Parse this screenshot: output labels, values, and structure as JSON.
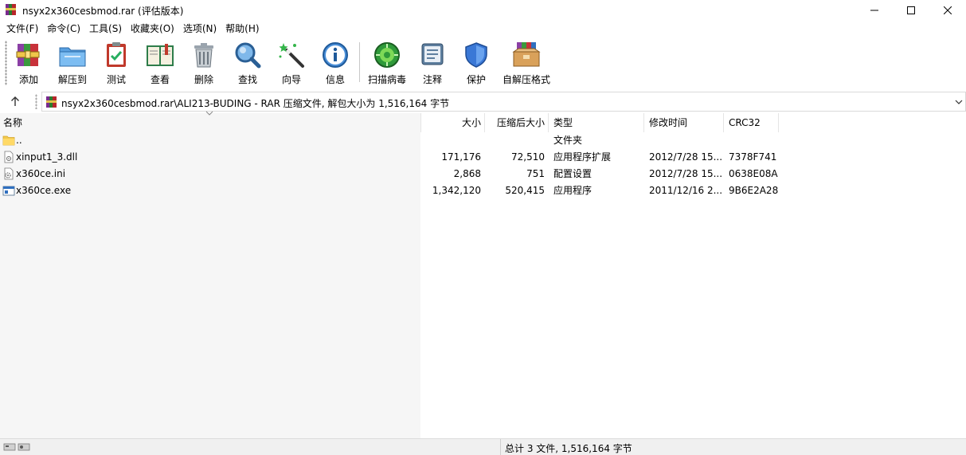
{
  "window": {
    "title": "nsyx2x360cesbmod.rar (评估版本)"
  },
  "menu": [
    "文件(F)",
    "命令(C)",
    "工具(S)",
    "收藏夹(O)",
    "选项(N)",
    "帮助(H)"
  ],
  "toolbar": {
    "buttons": [
      {
        "label": "添加",
        "icon": "add-archive-icon"
      },
      {
        "label": "解压到",
        "icon": "extract-folder-icon"
      },
      {
        "label": "测试",
        "icon": "test-clipboard-icon"
      },
      {
        "label": "查看",
        "icon": "view-book-icon"
      },
      {
        "label": "删除",
        "icon": "trash-icon"
      },
      {
        "label": "查找",
        "icon": "magnifier-icon"
      },
      {
        "label": "向导",
        "icon": "wizard-wand-icon"
      },
      {
        "label": "信息",
        "icon": "info-icon"
      },
      {
        "label": "扫描病毒",
        "icon": "virus-scan-icon"
      },
      {
        "label": "注释",
        "icon": "comment-icon"
      },
      {
        "label": "保护",
        "icon": "shield-icon"
      },
      {
        "label": "自解压格式",
        "icon": "sfx-box-icon"
      }
    ]
  },
  "address": {
    "path": "nsyx2x360cesbmod.rar\\ALI213-BUDING - RAR 压缩文件, 解包大小为 1,516,164 字节"
  },
  "columns": {
    "name": "名称",
    "size": "大小",
    "packed": "压缩后大小",
    "type": "类型",
    "modified": "修改时间",
    "crc": "CRC32"
  },
  "files": [
    {
      "name": "..",
      "size": "",
      "packed": "",
      "type": "文件夹",
      "modified": "",
      "crc": "",
      "icon": "folder-icon"
    },
    {
      "name": "xinput1_3.dll",
      "size": "171,176",
      "packed": "72,510",
      "type": "应用程序扩展",
      "modified": "2012/7/28 15...",
      "crc": "7378F741",
      "icon": "dll-file-icon"
    },
    {
      "name": "x360ce.ini",
      "size": "2,868",
      "packed": "751",
      "type": "配置设置",
      "modified": "2012/7/28 15...",
      "crc": "0638E08A",
      "icon": "ini-file-icon"
    },
    {
      "name": "x360ce.exe",
      "size": "1,342,120",
      "packed": "520,415",
      "type": "应用程序",
      "modified": "2011/12/16 2...",
      "crc": "9B6E2A28",
      "icon": "exe-file-icon"
    }
  ],
  "status": {
    "summary": "总计 3 文件, 1,516,164 字节"
  }
}
